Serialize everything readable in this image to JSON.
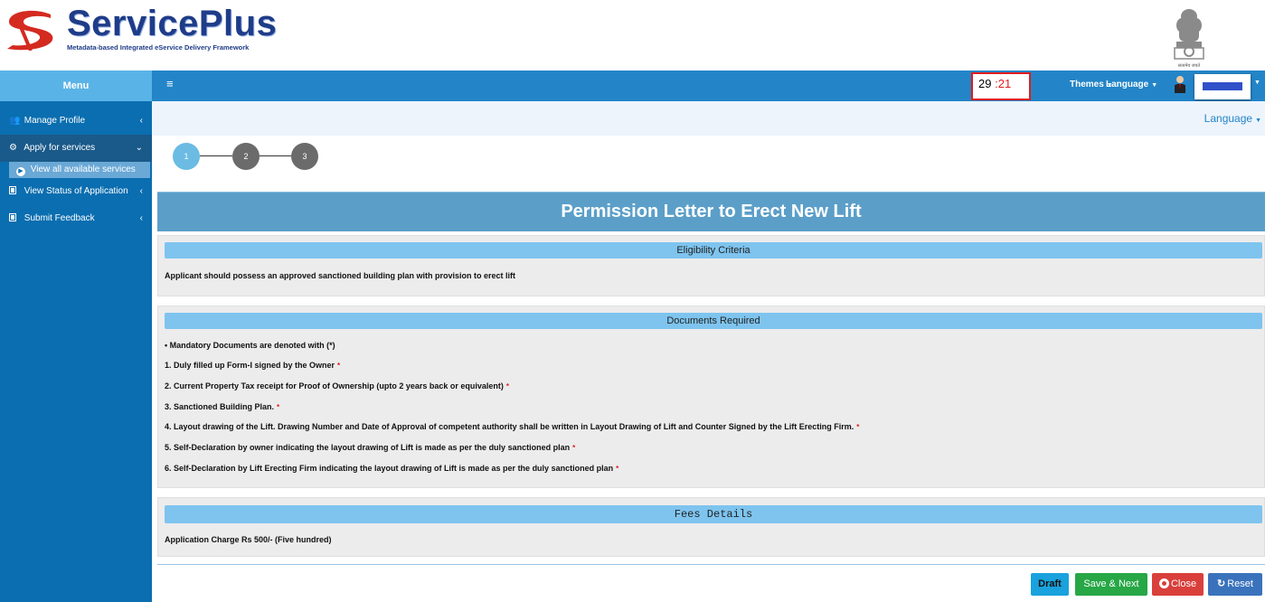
{
  "brand": {
    "title": "ServicePlus",
    "subtitle": "Metadata-based Integrated eService Delivery Framework",
    "emblem_caption": "सत्यमेव जयते"
  },
  "topbar": {
    "menu_label": "Menu",
    "hamburger_icon": "hamburger-icon",
    "timer_minutes": "29",
    "timer_separator": ":",
    "timer_seconds": "21",
    "themes_label": "Themes",
    "language_label": "Language",
    "user_icon": "user-icon"
  },
  "sidebar": {
    "items": [
      {
        "label": "Manage Profile",
        "icon": "users-icon"
      },
      {
        "label": "Apply for services",
        "icon": "gears-icon"
      },
      {
        "label": "View all available services",
        "icon": "arrow-circle-icon"
      },
      {
        "label": "View Status of Application",
        "icon": "square-icon"
      },
      {
        "label": "Submit Feedback",
        "icon": "square-icon"
      }
    ]
  },
  "content": {
    "language_link": "Language",
    "steps": [
      "1",
      "2",
      "3"
    ],
    "page_title": "Permission Letter to Erect New Lift"
  },
  "eligibility": {
    "heading": "Eligibility Criteria",
    "text": "Applicant should possess an approved sanctioned building plan with provision to erect lift"
  },
  "documents": {
    "heading": "Documents Required",
    "note": "• Mandatory Documents are denoted with (*)",
    "items": [
      "1. Duly filled up Form-I signed by the Owner",
      "2. Current Property Tax receipt for Proof of Ownership (upto 2 years back or equivalent)",
      "3. Sanctioned Building Plan.",
      "4. Layout drawing of the Lift. Drawing Number and Date of Approval of competent authority shall be written in Layout Drawing of Lift and Counter Signed by the Lift Erecting Firm.",
      "5. Self-Declaration by owner indicating the layout drawing of Lift is made as per the duly sanctioned plan",
      "6. Self-Declaration by Lift Erecting Firm indicating the layout drawing of Lift is made as per the duly sanctioned plan"
    ],
    "required_mark": "*"
  },
  "fees": {
    "heading": "Fees Details",
    "text": "Application Charge Rs 500/- (Five hundred)"
  },
  "actions": {
    "draft": "Draft",
    "save_next": "Save & Next",
    "close": "Close",
    "reset": "Reset"
  },
  "colors": {
    "topbar": "#2385c8",
    "sidebar": "#0a6eb0",
    "title_band": "#5b9fc9",
    "panel_heading": "#7ec4ef",
    "required": "#e01b1b"
  }
}
